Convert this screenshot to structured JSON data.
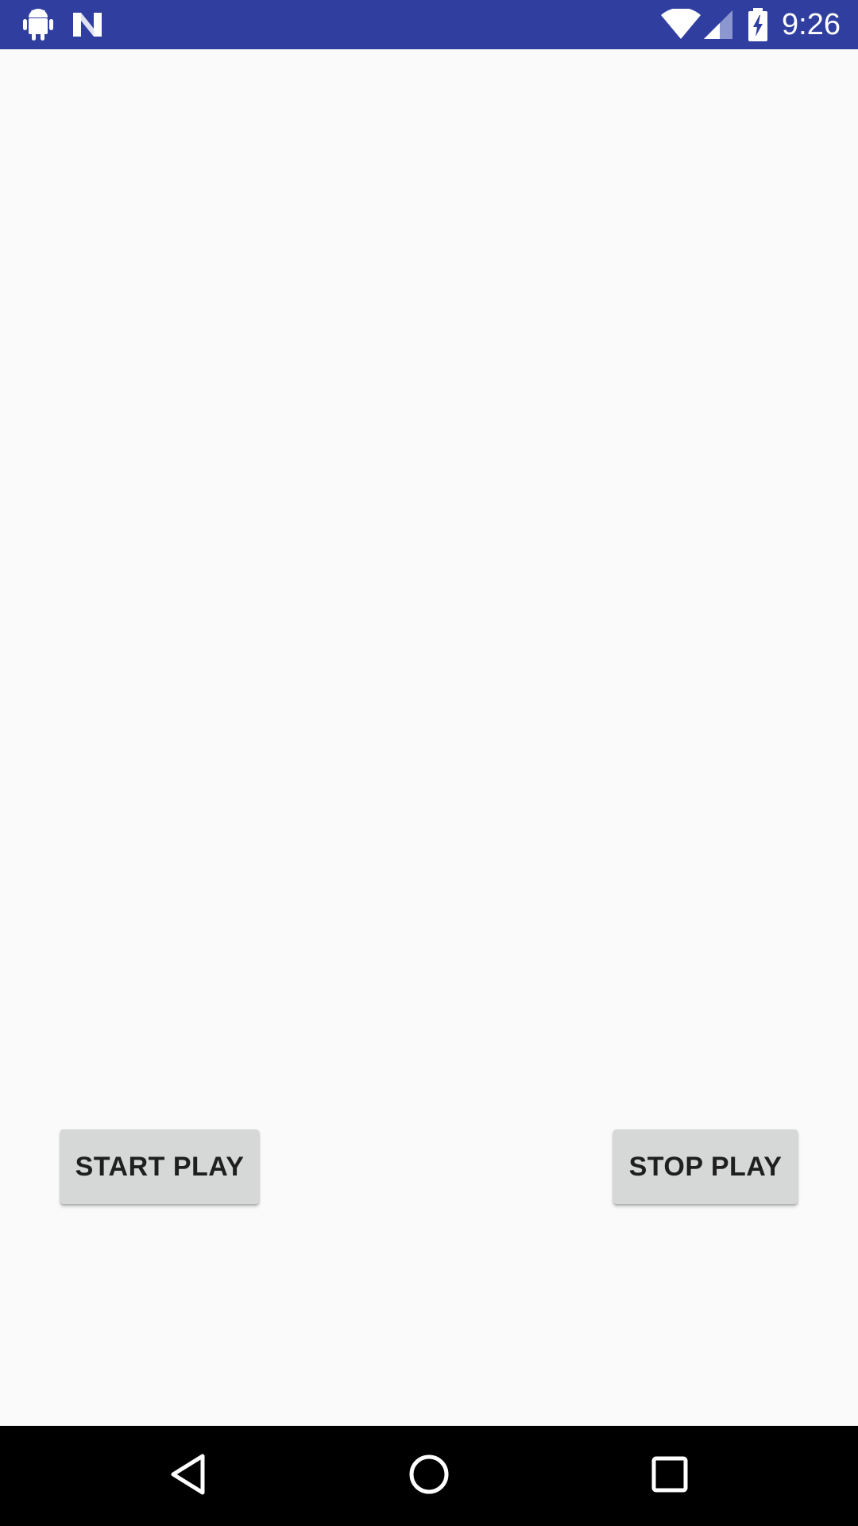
{
  "status_bar": {
    "time": "9:26",
    "background_color": "#303f9f",
    "icons": [
      "android-icon",
      "n-notification-icon",
      "wifi-icon",
      "cell-signal-icon",
      "battery-charging-icon"
    ]
  },
  "main": {
    "start_button_label": "START PLAY",
    "stop_button_label": "STOP PLAY"
  },
  "nav_bar": {
    "icons": [
      "back-icon",
      "home-icon",
      "recents-icon"
    ]
  }
}
